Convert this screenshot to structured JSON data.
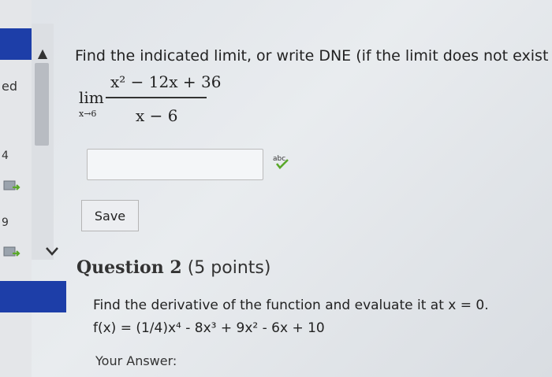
{
  "sidebar": {
    "label_top": "ed",
    "num_a": "4",
    "num_b": "9"
  },
  "question1": {
    "prompt": "Find the indicated limit, or write DNE (if the limit does not exist",
    "lim_word": "lim",
    "lim_sub": "x→6",
    "numerator": "x² − 12x + 36",
    "denominator": "x − 6",
    "answer_value": "",
    "save_label": "Save",
    "spell_label": "abc"
  },
  "question2": {
    "title_bold": "Question 2",
    "points": "(5 points)",
    "prompt": "Find the derivative of the function and evaluate it at x = 0.",
    "formula": "f(x) = (1/4)x⁴ - 8x³ + 9x² - 6x + 10",
    "answer_label": "Your Answer:"
  },
  "colors": {
    "accent_blue": "#1d3ea8",
    "check_green": "#5aa82a"
  }
}
